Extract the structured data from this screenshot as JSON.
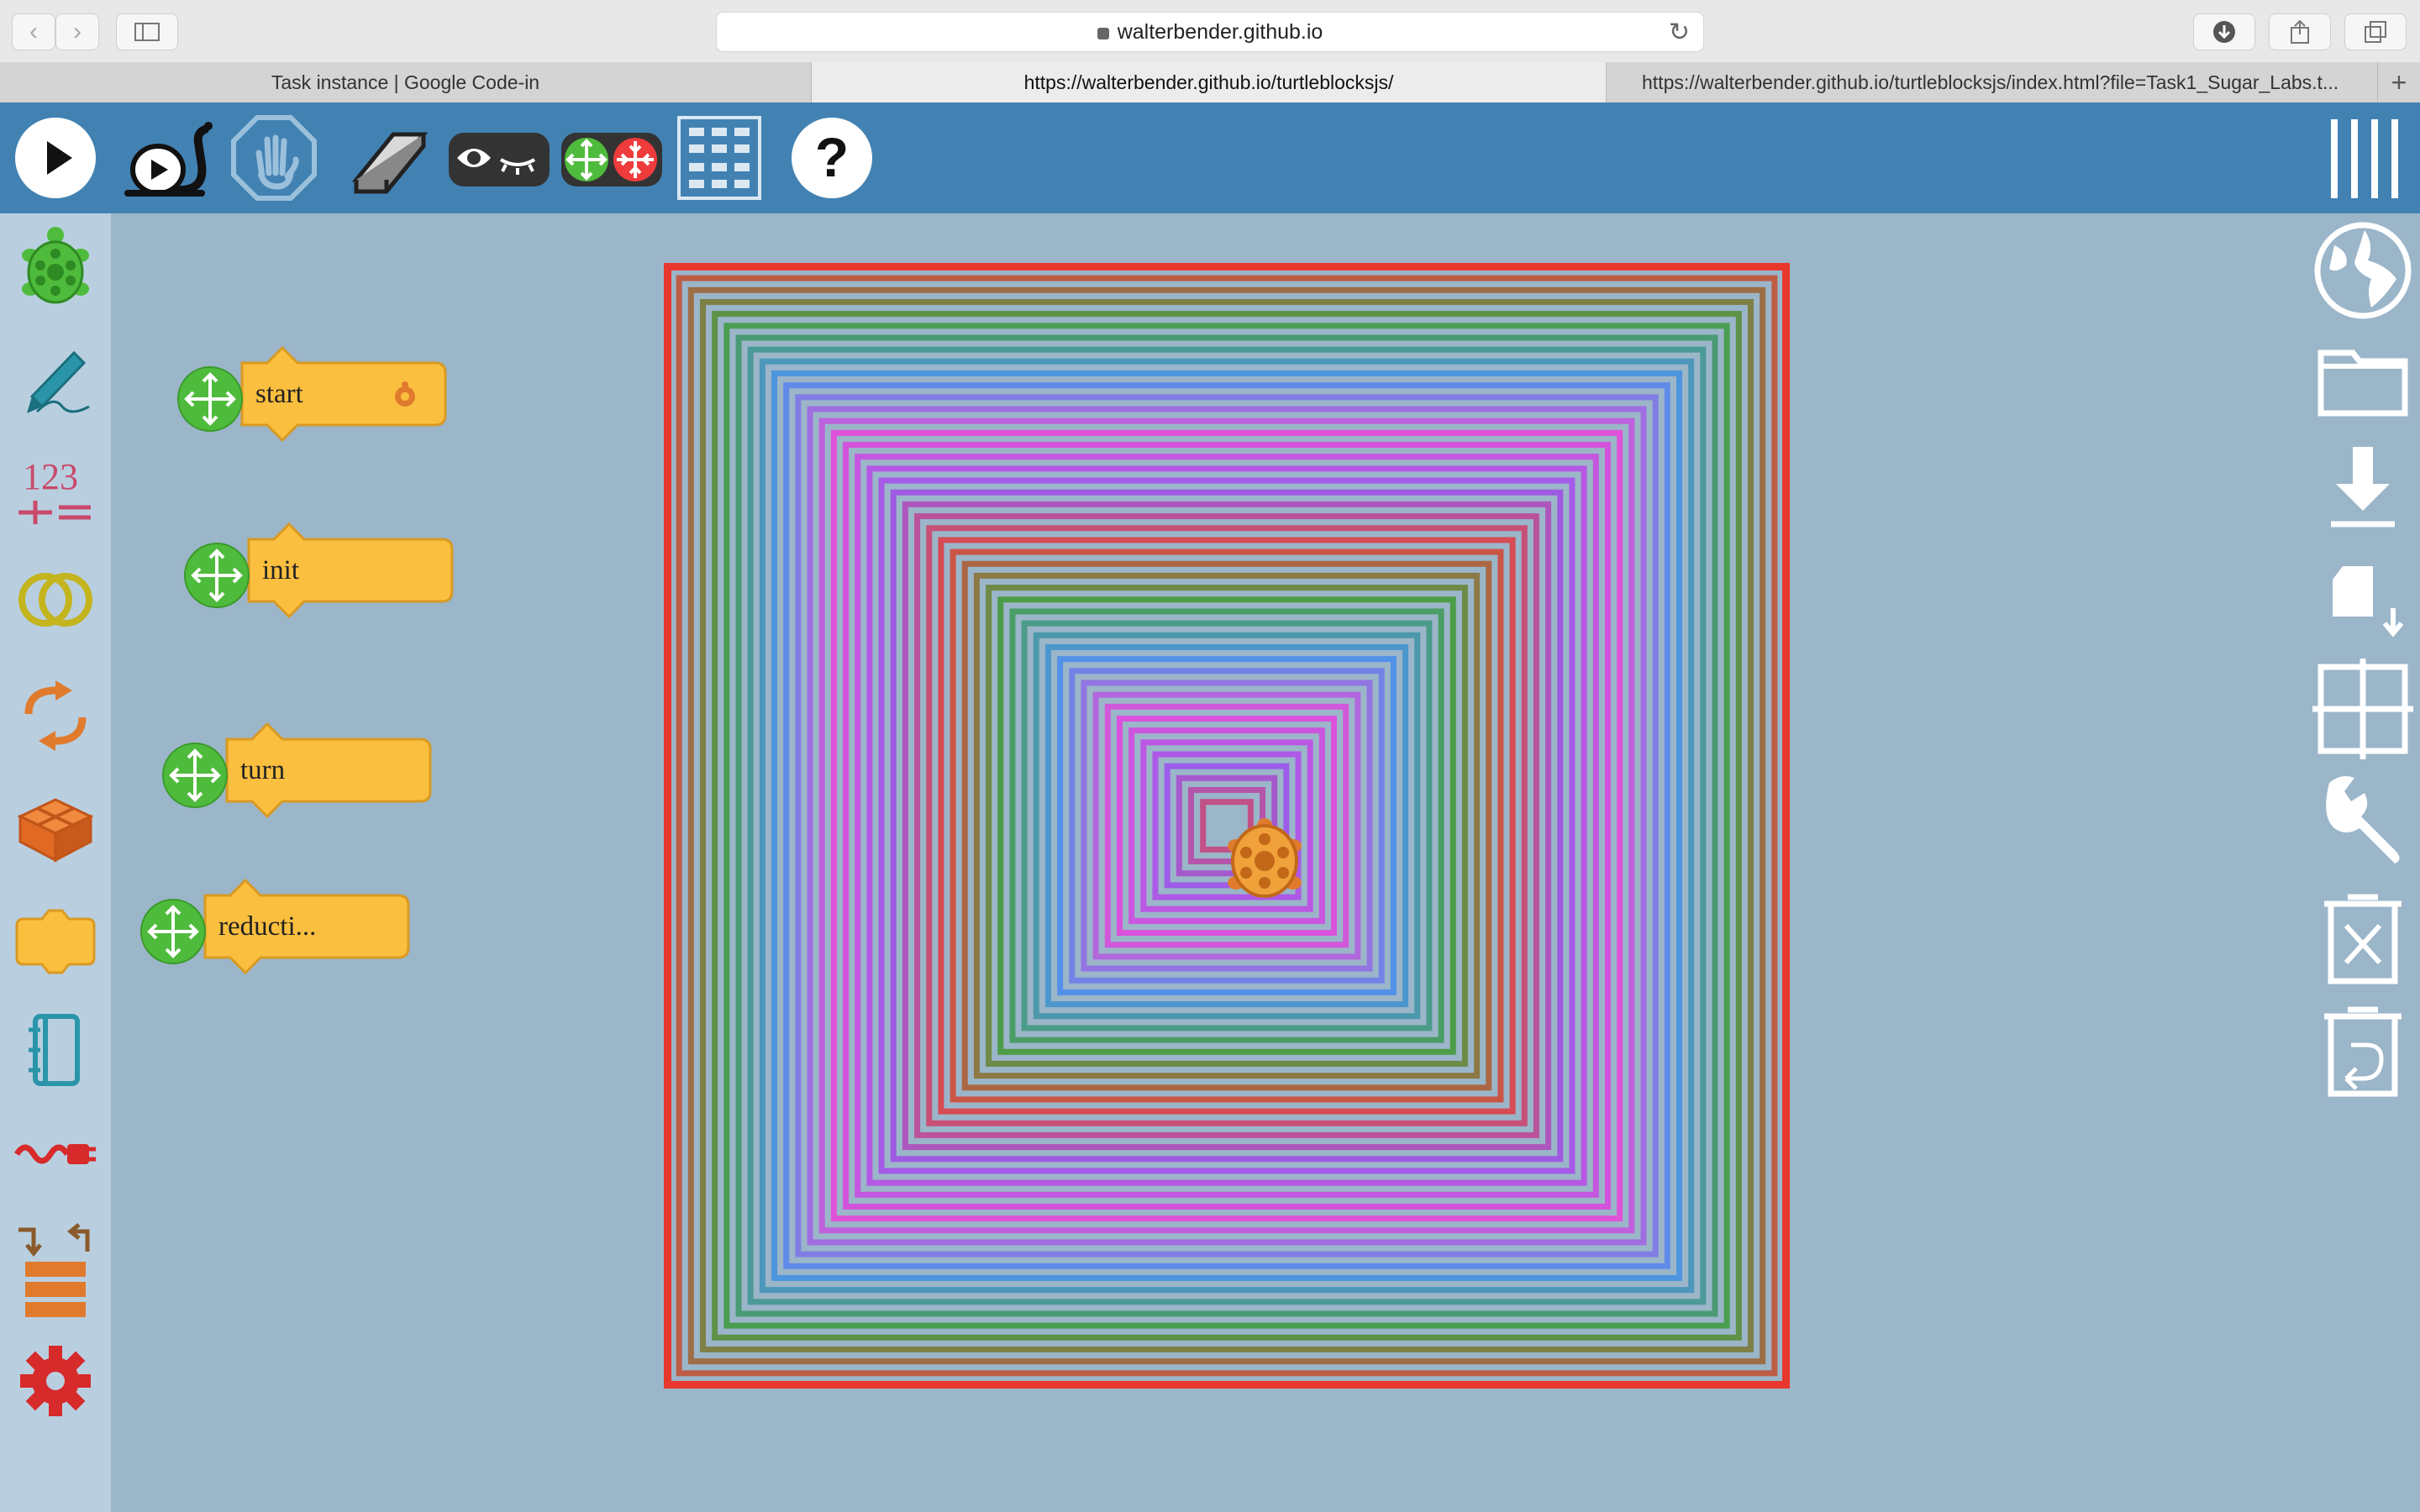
{
  "browser": {
    "address": "walterbender.github.io",
    "tabs": [
      {
        "label": "Task instance | Google Code-in",
        "active": false
      },
      {
        "label": "https://walterbender.github.io/turtleblocksjs/",
        "active": true
      },
      {
        "label": "https://walterbender.github.io/turtleblocksjs/index.html?file=Task1_Sugar_Labs.t...",
        "active": false
      }
    ]
  },
  "toolbar": {
    "buttons": [
      "play-icon",
      "slow-play-snail-icon",
      "stop-hand-icon",
      "eraser-icon",
      "hide-blocks-eye-icon",
      "collapse-expand-icon",
      "grid-menu-icon",
      "help-icon"
    ]
  },
  "palette": {
    "items": [
      "turtle-icon",
      "pen-icon",
      "number-icon",
      "boolean-icon",
      "flow-icon",
      "box-icon",
      "action-icon",
      "media-icon",
      "sensors-icon",
      "extras-icon",
      "settings-gear-icon"
    ],
    "number_label": "123"
  },
  "blocks": [
    {
      "label": "start"
    },
    {
      "label": "init"
    },
    {
      "label": "turn"
    },
    {
      "label": "reducti..."
    }
  ],
  "aux_menu": [
    "menu-bars-icon",
    "language-globe-icon",
    "open-folder-icon",
    "save-download-icon",
    "load-plugin-icon",
    "grid-icon",
    "tools-wrench-icon",
    "delete-trash-icon",
    "restore-trash-icon"
  ],
  "colors": {
    "toolbar": "#4282b3",
    "canvas_bg": "#9bb5c9",
    "palette_bg": "#b9cfe0",
    "block_fill": "#fbbf3f",
    "block_stroke": "#d99a23",
    "move_handle": "#4fbb3c"
  },
  "drawing": {
    "kind": "concentric-square-spiral",
    "line_count": 46,
    "color_cycle": [
      "#e8382d",
      "#3b9b30",
      "#3f8ef0",
      "#ee40dc",
      "#9b4cf0"
    ]
  }
}
